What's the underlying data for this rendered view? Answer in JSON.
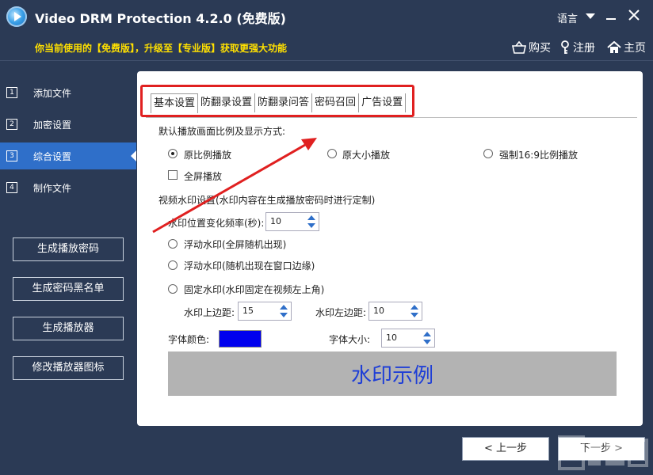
{
  "app": {
    "title": "Video DRM Protection 4.2.0 (免费版)"
  },
  "window": {
    "language_label": "语言"
  },
  "promo": {
    "text": "你当前使用的【免费版】，升级至【专业版】获取更强大功能"
  },
  "top_links": {
    "buy": "购买",
    "register": "注册",
    "home": "主页"
  },
  "sidebar": {
    "items": [
      {
        "num": "1",
        "label": "添加文件",
        "active": false
      },
      {
        "num": "2",
        "label": "加密设置",
        "active": false
      },
      {
        "num": "3",
        "label": "综合设置",
        "active": true
      },
      {
        "num": "4",
        "label": "制作文件",
        "active": false
      }
    ],
    "buttons": [
      "生成播放密码",
      "生成密码黑名单",
      "生成播放器",
      "修改播放器图标"
    ]
  },
  "tabs": [
    "基本设置",
    "防翻录设置",
    "防翻录问答",
    "密码召回",
    "广告设置"
  ],
  "settings": {
    "aspect_heading": "默认播放画面比例及显示方式:",
    "aspect_options": [
      "原比例播放",
      "原大小播放",
      "强制16:9比例播放"
    ],
    "aspect_selected": "原比例播放",
    "fullscreen_label": "全屏播放",
    "watermark_heading": "视频水印设置(水印内容在生成播放密码时进行定制)",
    "freq_label": "水印位置变化频率(秒):",
    "freq_value": "10",
    "wm_options": [
      "浮动水印(全屏随机出现)",
      "浮动水印(随机出现在窗口边缘)",
      "固定水印(水印固定在视频左上角)"
    ],
    "top_margin_label": "水印上边距:",
    "top_margin_value": "15",
    "left_margin_label": "水印左边距:",
    "left_margin_value": "10",
    "font_color_label": "字体颜色:",
    "font_color": "#0000ee",
    "font_size_label": "字体大小:",
    "font_size_value": "10",
    "preview_text": "水印示例"
  },
  "nav_buttons": {
    "prev": "< 上一步",
    "next": "下一步 >"
  },
  "colors": {
    "background": "#2b3a55",
    "accent": "#2f6fc9",
    "promo": "#ffe000",
    "highlight": "#e02020",
    "watermark_text": "#1f3fd6"
  }
}
